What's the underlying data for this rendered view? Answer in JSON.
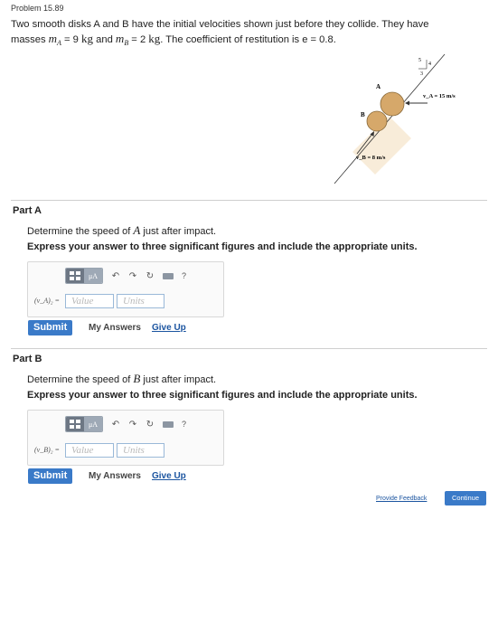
{
  "header": {
    "problem_title": "Problem 15.89"
  },
  "intro": {
    "line1": "Two smooth disks A and B have the initial velocities shown just before they collide. They have",
    "line2_pre": "masses",
    "mA_var": "m",
    "mA_sub": "A",
    "mA_eq": " = 9 ",
    "mA_unit": "kg",
    "and_text": " and ",
    "mB_var": "m",
    "mB_sub": "B",
    "mB_eq": " = 2 ",
    "mB_unit": "kg",
    "line2_post": ". The coefficient of restitution is e = 0.8."
  },
  "diagram": {
    "slope_top": "5",
    "slope_side": "4",
    "slope_bottom": "3",
    "label_A": "A",
    "label_B": "B",
    "vA_label": "v_A = 15 m/s",
    "vB_label": "v_B = 8 m/s"
  },
  "partA": {
    "heading": "Part A",
    "question_pre": "Determine the speed of ",
    "question_var": "A",
    "question_post": " just after impact.",
    "instruction": "Express your answer to three significant figures and include the appropriate units.",
    "answer_label": "(v_A)₂ =",
    "value_placeholder": "Value",
    "units_placeholder": "Units",
    "submit_label": "Submit",
    "my_answers_label": "My Answers",
    "give_up_label": "Give Up"
  },
  "partB": {
    "heading": "Part B",
    "question_pre": "Determine the speed of ",
    "question_var": "B",
    "question_post": " just after impact.",
    "instruction": "Express your answer to three significant figures and include the appropriate units.",
    "answer_label": "(v_B)₂ =",
    "value_placeholder": "Value",
    "units_placeholder": "Units",
    "submit_label": "Submit",
    "my_answers_label": "My Answers",
    "give_up_label": "Give Up"
  },
  "toolbar": {
    "mu_label": "μA",
    "help_label": "?",
    "icons": [
      "templates-icon",
      "units-icon",
      "undo-icon",
      "redo-icon",
      "reset-icon",
      "keyboard-icon",
      "help-icon"
    ]
  },
  "footer": {
    "feedback_label": "Provide Feedback",
    "continue_label": "Continue"
  },
  "colors": {
    "primary_button": "#3a7ac8",
    "link": "#1c55a0",
    "disk_fill": "#d6a86a"
  }
}
